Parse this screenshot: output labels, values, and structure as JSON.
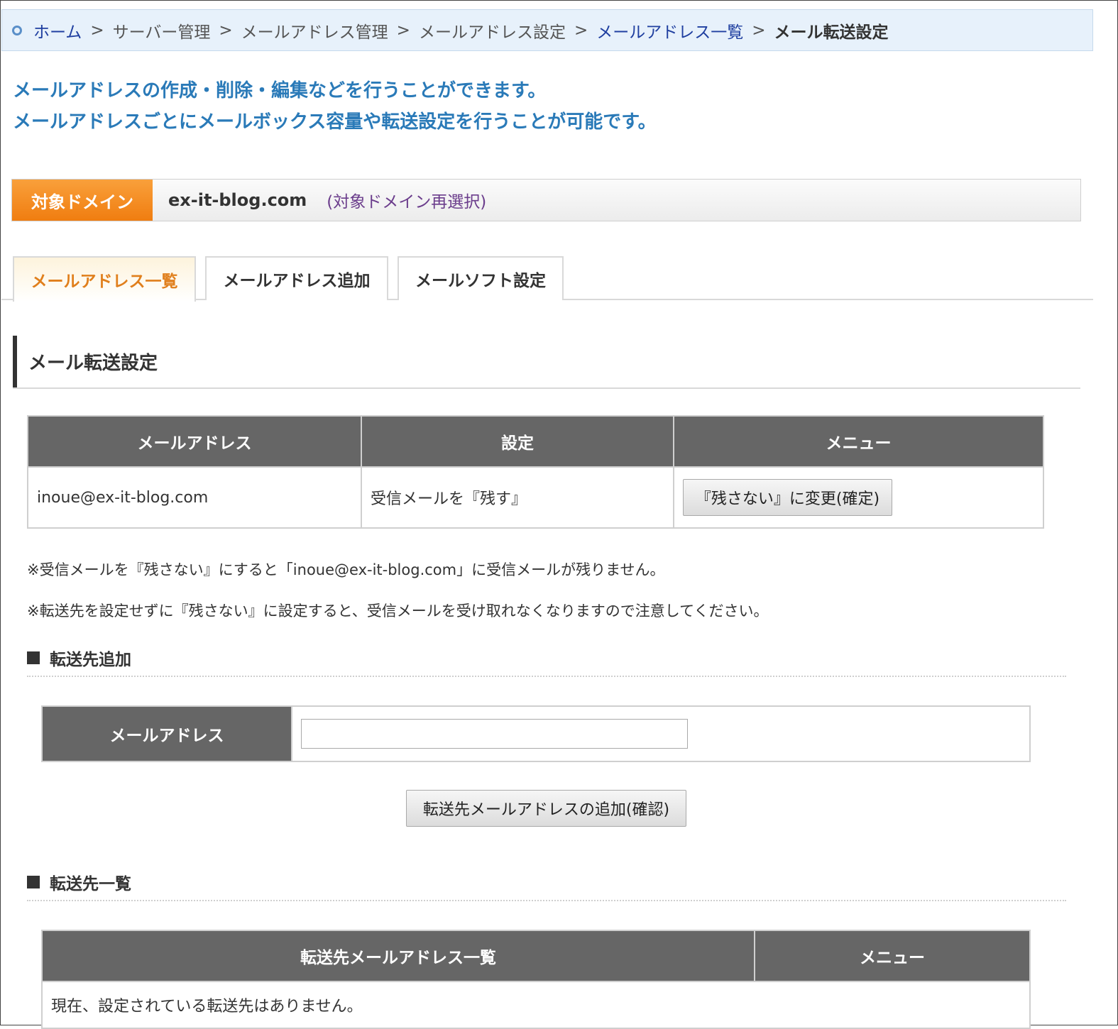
{
  "breadcrumb": {
    "home": "ホーム",
    "server": "サーバー管理",
    "mail_admin": "メールアドレス管理",
    "mail_settings": "メールアドレス設定",
    "mail_list": "メールアドレス一覧",
    "current": "メール転送設定",
    "separator": ">"
  },
  "intro": {
    "line1": "メールアドレスの作成・削除・編集などを行うことができます。",
    "line2": "メールアドレスごとにメールボックス容量や転送設定を行うことが可能です。"
  },
  "domain": {
    "label": "対象ドメイン",
    "name": "ex-it-blog.com",
    "reselect": "(対象ドメイン再選択)"
  },
  "tabs": [
    {
      "label": "メールアドレス一覧",
      "active": true
    },
    {
      "label": "メールアドレス追加",
      "active": false
    },
    {
      "label": "メールソフト設定",
      "active": false
    }
  ],
  "section_title": "メール転送設定",
  "settings_table": {
    "headers": [
      "メールアドレス",
      "設定",
      "メニュー"
    ],
    "row": {
      "email": "inoue@ex-it-blog.com",
      "setting": "受信メールを『残す』",
      "button": "『残さない』に変更(確定)"
    }
  },
  "notes": [
    "※受信メールを『残さない』にすると「inoue@ex-it-blog.com」に受信メールが残りません。",
    "※転送先を設定せずに『残さない』に設定すると、受信メールを受け取れなくなりますので注意してください。"
  ],
  "add_forward": {
    "heading": "転送先追加",
    "field_label": "メールアドレス",
    "input_value": "",
    "button": "転送先メールアドレスの追加(確認)"
  },
  "forward_list": {
    "heading": "転送先一覧",
    "headers": [
      "転送先メールアドレス一覧",
      "メニュー"
    ],
    "empty_text": "現在、設定されている転送先はありません。"
  }
}
